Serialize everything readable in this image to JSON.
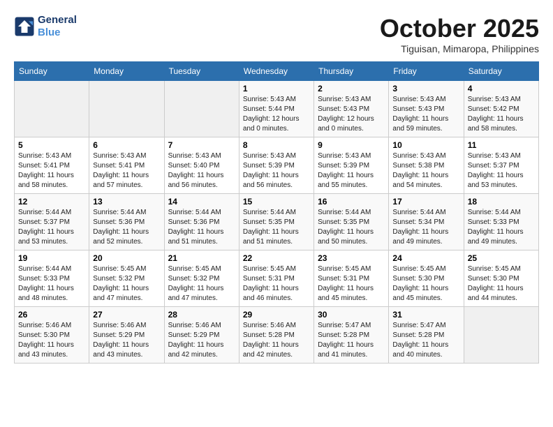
{
  "header": {
    "logo_line1": "General",
    "logo_line2": "Blue",
    "month_title": "October 2025",
    "location": "Tiguisan, Mimaropa, Philippines"
  },
  "weekdays": [
    "Sunday",
    "Monday",
    "Tuesday",
    "Wednesday",
    "Thursday",
    "Friday",
    "Saturday"
  ],
  "weeks": [
    [
      {
        "num": "",
        "info": ""
      },
      {
        "num": "",
        "info": ""
      },
      {
        "num": "",
        "info": ""
      },
      {
        "num": "1",
        "info": "Sunrise: 5:43 AM\nSunset: 5:44 PM\nDaylight: 12 hours\nand 0 minutes."
      },
      {
        "num": "2",
        "info": "Sunrise: 5:43 AM\nSunset: 5:43 PM\nDaylight: 12 hours\nand 0 minutes."
      },
      {
        "num": "3",
        "info": "Sunrise: 5:43 AM\nSunset: 5:43 PM\nDaylight: 11 hours\nand 59 minutes."
      },
      {
        "num": "4",
        "info": "Sunrise: 5:43 AM\nSunset: 5:42 PM\nDaylight: 11 hours\nand 58 minutes."
      }
    ],
    [
      {
        "num": "5",
        "info": "Sunrise: 5:43 AM\nSunset: 5:41 PM\nDaylight: 11 hours\nand 58 minutes."
      },
      {
        "num": "6",
        "info": "Sunrise: 5:43 AM\nSunset: 5:41 PM\nDaylight: 11 hours\nand 57 minutes."
      },
      {
        "num": "7",
        "info": "Sunrise: 5:43 AM\nSunset: 5:40 PM\nDaylight: 11 hours\nand 56 minutes."
      },
      {
        "num": "8",
        "info": "Sunrise: 5:43 AM\nSunset: 5:39 PM\nDaylight: 11 hours\nand 56 minutes."
      },
      {
        "num": "9",
        "info": "Sunrise: 5:43 AM\nSunset: 5:39 PM\nDaylight: 11 hours\nand 55 minutes."
      },
      {
        "num": "10",
        "info": "Sunrise: 5:43 AM\nSunset: 5:38 PM\nDaylight: 11 hours\nand 54 minutes."
      },
      {
        "num": "11",
        "info": "Sunrise: 5:43 AM\nSunset: 5:37 PM\nDaylight: 11 hours\nand 53 minutes."
      }
    ],
    [
      {
        "num": "12",
        "info": "Sunrise: 5:44 AM\nSunset: 5:37 PM\nDaylight: 11 hours\nand 53 minutes."
      },
      {
        "num": "13",
        "info": "Sunrise: 5:44 AM\nSunset: 5:36 PM\nDaylight: 11 hours\nand 52 minutes."
      },
      {
        "num": "14",
        "info": "Sunrise: 5:44 AM\nSunset: 5:36 PM\nDaylight: 11 hours\nand 51 minutes."
      },
      {
        "num": "15",
        "info": "Sunrise: 5:44 AM\nSunset: 5:35 PM\nDaylight: 11 hours\nand 51 minutes."
      },
      {
        "num": "16",
        "info": "Sunrise: 5:44 AM\nSunset: 5:35 PM\nDaylight: 11 hours\nand 50 minutes."
      },
      {
        "num": "17",
        "info": "Sunrise: 5:44 AM\nSunset: 5:34 PM\nDaylight: 11 hours\nand 49 minutes."
      },
      {
        "num": "18",
        "info": "Sunrise: 5:44 AM\nSunset: 5:33 PM\nDaylight: 11 hours\nand 49 minutes."
      }
    ],
    [
      {
        "num": "19",
        "info": "Sunrise: 5:44 AM\nSunset: 5:33 PM\nDaylight: 11 hours\nand 48 minutes."
      },
      {
        "num": "20",
        "info": "Sunrise: 5:45 AM\nSunset: 5:32 PM\nDaylight: 11 hours\nand 47 minutes."
      },
      {
        "num": "21",
        "info": "Sunrise: 5:45 AM\nSunset: 5:32 PM\nDaylight: 11 hours\nand 47 minutes."
      },
      {
        "num": "22",
        "info": "Sunrise: 5:45 AM\nSunset: 5:31 PM\nDaylight: 11 hours\nand 46 minutes."
      },
      {
        "num": "23",
        "info": "Sunrise: 5:45 AM\nSunset: 5:31 PM\nDaylight: 11 hours\nand 45 minutes."
      },
      {
        "num": "24",
        "info": "Sunrise: 5:45 AM\nSunset: 5:30 PM\nDaylight: 11 hours\nand 45 minutes."
      },
      {
        "num": "25",
        "info": "Sunrise: 5:45 AM\nSunset: 5:30 PM\nDaylight: 11 hours\nand 44 minutes."
      }
    ],
    [
      {
        "num": "26",
        "info": "Sunrise: 5:46 AM\nSunset: 5:30 PM\nDaylight: 11 hours\nand 43 minutes."
      },
      {
        "num": "27",
        "info": "Sunrise: 5:46 AM\nSunset: 5:29 PM\nDaylight: 11 hours\nand 43 minutes."
      },
      {
        "num": "28",
        "info": "Sunrise: 5:46 AM\nSunset: 5:29 PM\nDaylight: 11 hours\nand 42 minutes."
      },
      {
        "num": "29",
        "info": "Sunrise: 5:46 AM\nSunset: 5:28 PM\nDaylight: 11 hours\nand 42 minutes."
      },
      {
        "num": "30",
        "info": "Sunrise: 5:47 AM\nSunset: 5:28 PM\nDaylight: 11 hours\nand 41 minutes."
      },
      {
        "num": "31",
        "info": "Sunrise: 5:47 AM\nSunset: 5:28 PM\nDaylight: 11 hours\nand 40 minutes."
      },
      {
        "num": "",
        "info": ""
      }
    ]
  ]
}
